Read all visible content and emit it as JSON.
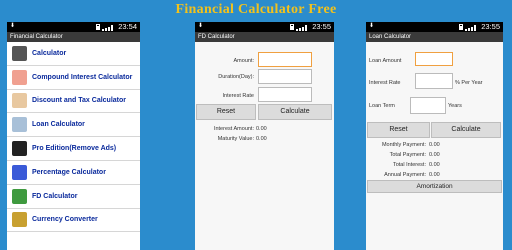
{
  "banner": {
    "title": "Financial Calculator Free"
  },
  "phone1": {
    "status_time": "23:54",
    "title": "Financial Calculator",
    "menu": [
      {
        "label": "Calculator",
        "icon": "calculator-icon",
        "color": "#555555"
      },
      {
        "label": "Compound Interest Calculator",
        "icon": "piggy-bank-icon",
        "color": "#f0a090"
      },
      {
        "label": "Discount and Tax Calculator",
        "icon": "hand-money-icon",
        "color": "#e8c8a0"
      },
      {
        "label": "Loan Calculator",
        "icon": "house-icon",
        "color": "#a8c0d8"
      },
      {
        "label": "Pro Edition(Remove Ads)",
        "icon": "badge-icon",
        "color": "#222222"
      },
      {
        "label": "Percentage Calculator",
        "icon": "percent-icon",
        "color": "#3a5ad8"
      },
      {
        "label": "FD Calculator",
        "icon": "fd-icon",
        "color": "#3f9a3f"
      },
      {
        "label": "Currency Converter",
        "icon": "currency-icon",
        "color": "#c8a030"
      }
    ]
  },
  "phone2": {
    "status_time": "23:55",
    "title": "FD Calculator",
    "fields": [
      {
        "label": "Amount:",
        "value": ""
      },
      {
        "label": "Duration(Day):",
        "value": ""
      },
      {
        "label": "Interest Rate",
        "value": ""
      }
    ],
    "reset_label": "Reset",
    "calculate_label": "Calculate",
    "results": [
      {
        "label": "Interest Amount:",
        "value": "0.00"
      },
      {
        "label": "Maturity Value:",
        "value": "0.00"
      }
    ]
  },
  "phone3": {
    "status_time": "23:55",
    "title": "Loan Calculator",
    "fields": [
      {
        "label": "Loan Amount",
        "value": "",
        "suffix": ""
      },
      {
        "label": "Interest Rate",
        "value": "",
        "suffix": "% Per Year"
      },
      {
        "label": "Loan Term",
        "value": "",
        "suffix": "Years"
      }
    ],
    "reset_label": "Reset",
    "calculate_label": "Calculate",
    "results": [
      {
        "label": "Monthly Payment:",
        "value": "0.00"
      },
      {
        "label": "Total Payment:",
        "value": "0.00"
      },
      {
        "label": "Total Interest:",
        "value": "0.00"
      },
      {
        "label": "Annual Payment:",
        "value": "0.00"
      }
    ],
    "amortization_label": "Amortization"
  },
  "colors": {
    "background": "#2b8ccd",
    "banner_title": "#f2c21c",
    "menu_text": "#0a2a9c"
  }
}
